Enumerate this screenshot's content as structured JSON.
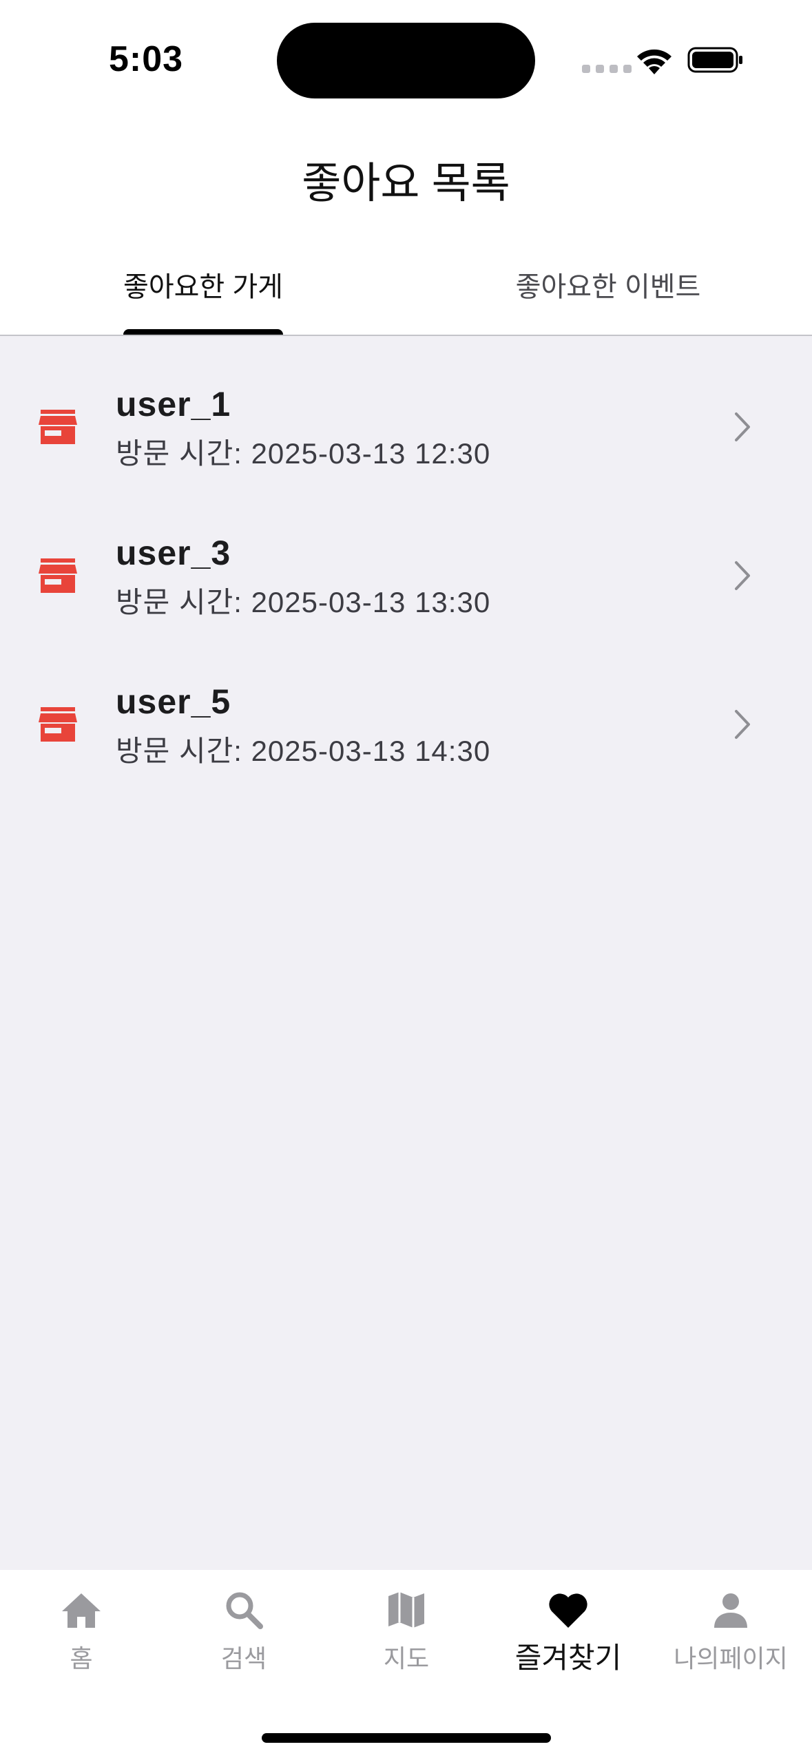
{
  "status_bar": {
    "time": "5:03"
  },
  "header": {
    "title": "좋아요 목록"
  },
  "tabs": [
    {
      "label": "좋아요한 가게",
      "selected": true
    },
    {
      "label": "좋아요한 이벤트",
      "selected": false
    }
  ],
  "list": {
    "items": [
      {
        "name": "user_1",
        "visit": "방문 시간: 2025-03-13 12:30",
        "icon": "store-icon"
      },
      {
        "name": "user_3",
        "visit": "방문 시간: 2025-03-13 13:30",
        "icon": "store-icon"
      },
      {
        "name": "user_5",
        "visit": "방문 시간: 2025-03-13 14:30",
        "icon": "store-icon"
      }
    ]
  },
  "tab_bar": {
    "items": [
      {
        "label": "홈",
        "icon": "home-icon",
        "active": false
      },
      {
        "label": "검색",
        "icon": "search-icon",
        "active": false
      },
      {
        "label": "지도",
        "icon": "map-icon",
        "active": false
      },
      {
        "label": "즐겨찾기",
        "icon": "heart-icon",
        "active": true
      },
      {
        "label": "나의페이지",
        "icon": "person-icon",
        "active": false
      }
    ]
  },
  "colors": {
    "accent": "#e8443a",
    "background": "#f1f0f5",
    "inactive": "#9a9a9e"
  }
}
